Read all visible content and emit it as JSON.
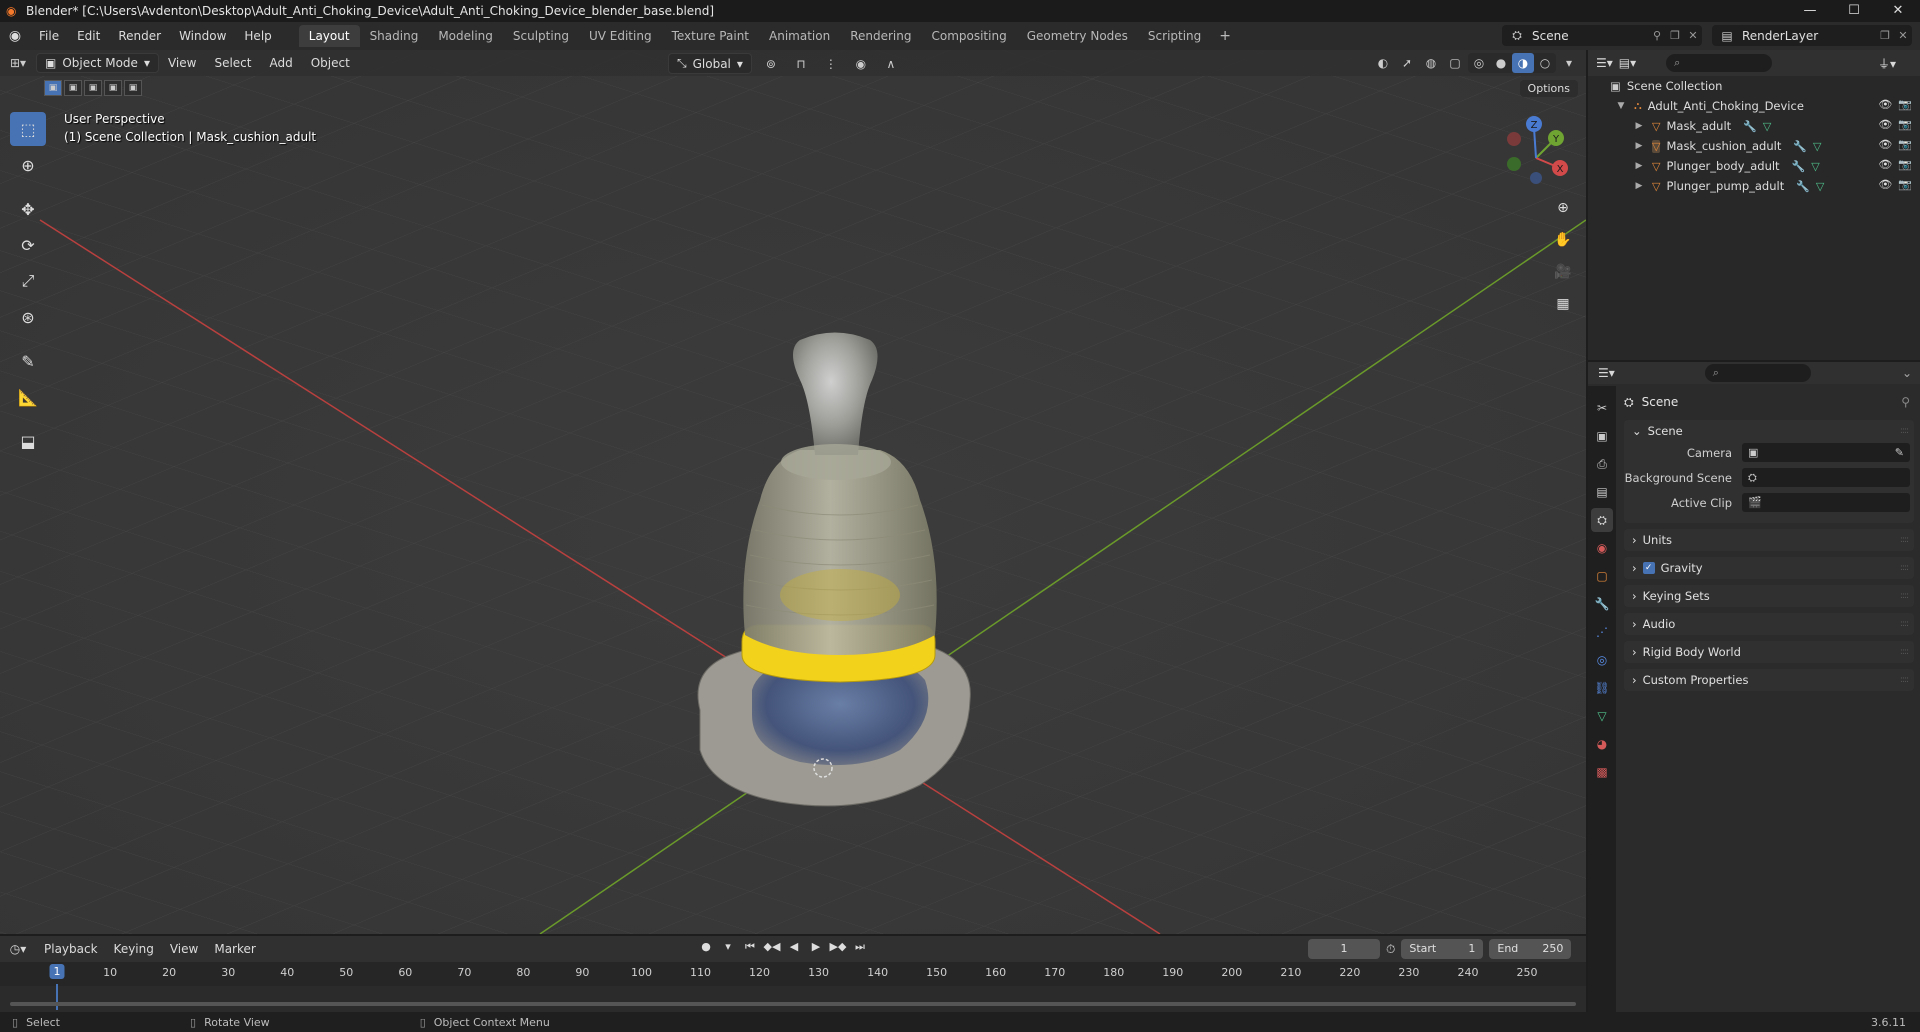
{
  "window": {
    "title": "Blender* [C:\\Users\\Avdenton\\Desktop\\Adult_Anti_Choking_Device\\Adult_Anti_Choking_Device_blender_base.blend]",
    "controls": [
      "—",
      "☐",
      "✕"
    ]
  },
  "menu": {
    "items": [
      "File",
      "Edit",
      "Render",
      "Window",
      "Help"
    ],
    "workspaces": [
      "Layout",
      "Shading",
      "Modeling",
      "Sculpting",
      "UV Editing",
      "Texture Paint",
      "Animation",
      "Rendering",
      "Compositing",
      "Geometry Nodes",
      "Scripting"
    ],
    "active_workspace": "Layout",
    "add_workspace": "+",
    "scene_name": "Scene",
    "render_layer": "RenderLayer"
  },
  "viewport": {
    "mode": "Object Mode",
    "menus": [
      "View",
      "Select",
      "Add",
      "Object"
    ],
    "transform_orientation": "Global",
    "options_label": "Options",
    "perspective_label": "User Perspective",
    "collection_label": "(1) Scene Collection | Mask_cushion_adult",
    "gizmo_axes": {
      "x": "X",
      "y": "Y",
      "z": "Z"
    },
    "colors": {
      "x_axis": "#c8403f",
      "y_axis": "#6e9a2c",
      "accent": "#4772b3",
      "yellow_ring": "#f3d21b"
    }
  },
  "outliner": {
    "root": "Scene Collection",
    "collection": "Adult_Anti_Choking_Device",
    "objects": [
      "Mask_adult",
      "Mask_cushion_adult",
      "Plunger_body_adult",
      "Plunger_pump_adult"
    ],
    "selected": "Mask_cushion_adult"
  },
  "properties": {
    "context": "Scene",
    "scene_panel": {
      "title": "Scene",
      "camera_label": "Camera",
      "background_scene_label": "Background Scene",
      "active_clip_label": "Active Clip"
    },
    "panels": [
      "Units",
      "Gravity",
      "Keying Sets",
      "Audio",
      "Rigid Body World",
      "Custom Properties"
    ],
    "gravity_enabled": true
  },
  "timeline": {
    "menus": [
      "Playback",
      "Keying",
      "View",
      "Marker"
    ],
    "current_frame": "1",
    "start_label": "Start",
    "start_value": "1",
    "end_label": "End",
    "end_value": "250",
    "ticks": [
      "10",
      "20",
      "30",
      "40",
      "50",
      "60",
      "70",
      "80",
      "90",
      "100",
      "110",
      "120",
      "130",
      "140",
      "150",
      "160",
      "170",
      "180",
      "190",
      "200",
      "210",
      "220",
      "230",
      "240",
      "250"
    ]
  },
  "status": {
    "select": "Select",
    "rotate_view": "Rotate View",
    "context_menu": "Object Context Menu",
    "version": "3.6.11"
  }
}
